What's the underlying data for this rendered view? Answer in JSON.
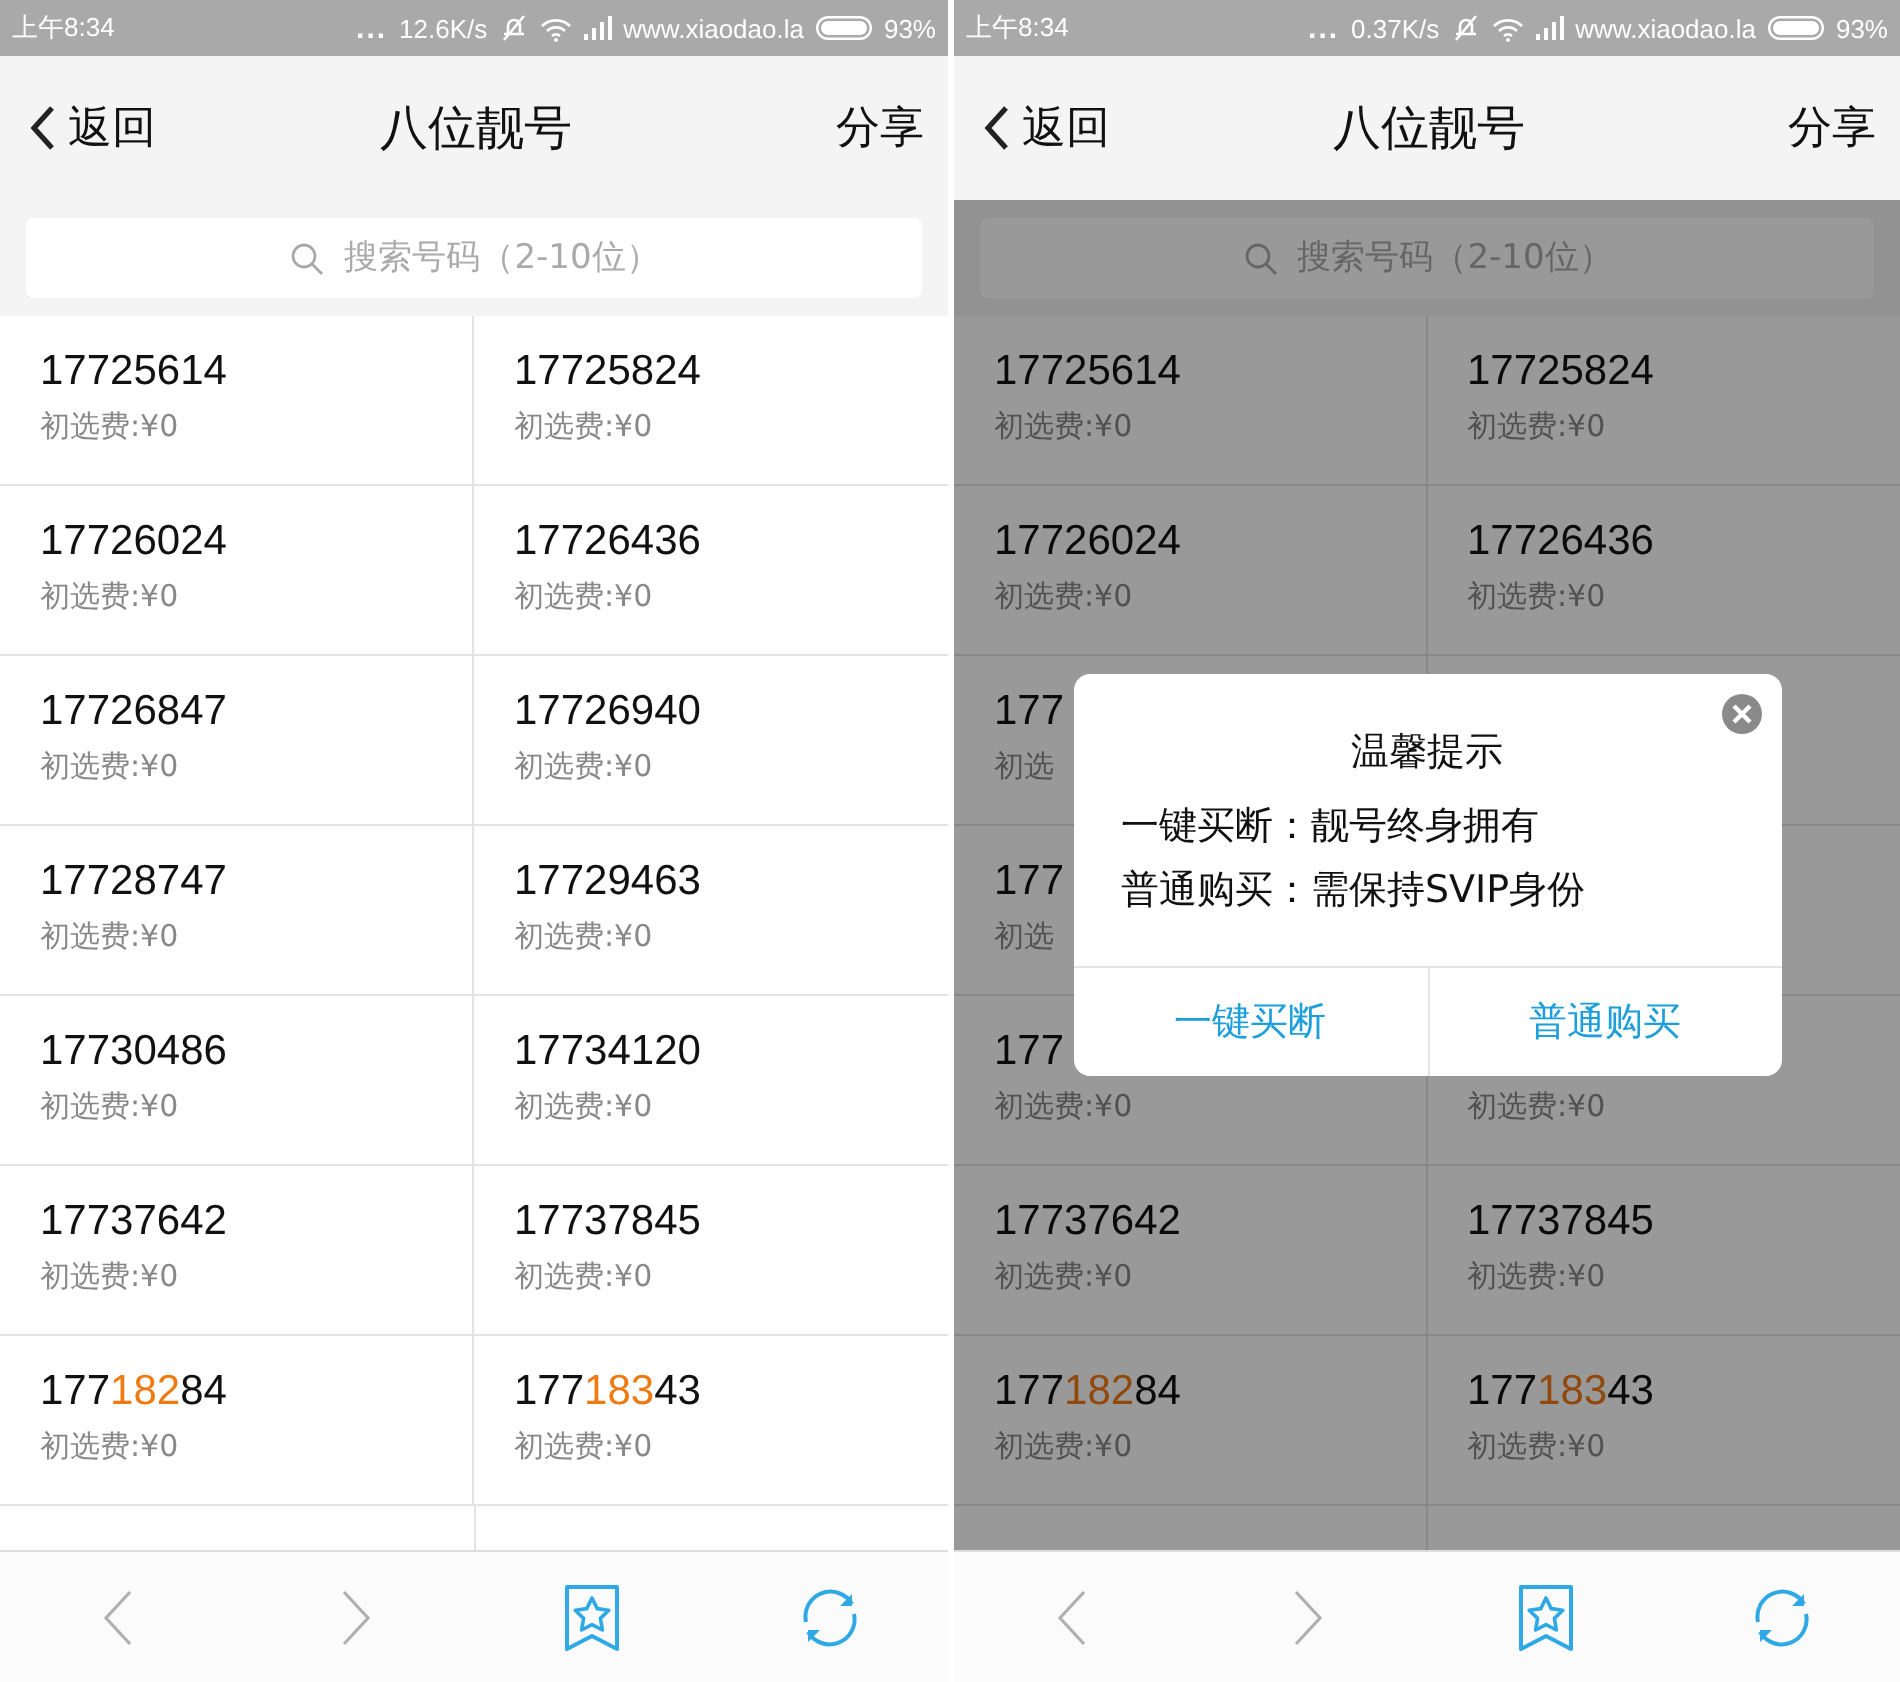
{
  "screens": [
    {
      "dimmed": false,
      "status_bar": {
        "time": "上午8:34",
        "dots": "...",
        "speed": "12.6K/s",
        "site": "www.xiaodao.la",
        "battery": "93%"
      },
      "header": {
        "back": "返回",
        "title": "八位靓号",
        "share": "分享"
      },
      "search": {
        "placeholder": "搜索号码（2-10位）"
      },
      "rows": [
        {
          "cells": [
            {
              "parts": [
                {
                  "text": "17725614",
                  "highlighted": false
                }
              ],
              "fee": "初选费:¥0"
            },
            {
              "parts": [
                {
                  "text": "17725824",
                  "highlighted": false
                }
              ],
              "fee": "初选费:¥0"
            }
          ]
        },
        {
          "cells": [
            {
              "parts": [
                {
                  "text": "17726024",
                  "highlighted": false
                }
              ],
              "fee": "初选费:¥0"
            },
            {
              "parts": [
                {
                  "text": "17726436",
                  "highlighted": false
                }
              ],
              "fee": "初选费:¥0"
            }
          ]
        },
        {
          "cells": [
            {
              "parts": [
                {
                  "text": "17726847",
                  "highlighted": false
                }
              ],
              "fee": "初选费:¥0"
            },
            {
              "parts": [
                {
                  "text": "17726940",
                  "highlighted": false
                }
              ],
              "fee": "初选费:¥0"
            }
          ]
        },
        {
          "cells": [
            {
              "parts": [
                {
                  "text": "17728747",
                  "highlighted": false
                }
              ],
              "fee": "初选费:¥0"
            },
            {
              "parts": [
                {
                  "text": "17729463",
                  "highlighted": false
                }
              ],
              "fee": "初选费:¥0"
            }
          ]
        },
        {
          "cells": [
            {
              "parts": [
                {
                  "text": "17730486",
                  "highlighted": false
                }
              ],
              "fee": "初选费:¥0"
            },
            {
              "parts": [
                {
                  "text": "17734120",
                  "highlighted": false
                }
              ],
              "fee": "初选费:¥0"
            }
          ]
        },
        {
          "cells": [
            {
              "parts": [
                {
                  "text": "17737642",
                  "highlighted": false
                }
              ],
              "fee": "初选费:¥0"
            },
            {
              "parts": [
                {
                  "text": "17737845",
                  "highlighted": false
                }
              ],
              "fee": "初选费:¥0"
            }
          ]
        },
        {
          "cells": [
            {
              "parts": [
                {
                  "text": "177",
                  "highlighted": false
                },
                {
                  "text": "182",
                  "highlighted": true
                },
                {
                  "text": "84",
                  "highlighted": false
                }
              ],
              "fee": "初选费:¥0"
            },
            {
              "parts": [
                {
                  "text": "177",
                  "highlighted": false
                },
                {
                  "text": "183",
                  "highlighted": true
                },
                {
                  "text": "43",
                  "highlighted": false
                }
              ],
              "fee": "初选费:¥0"
            }
          ]
        }
      ],
      "bottom_nav": [
        {
          "kind": "back",
          "disabled": true
        },
        {
          "kind": "forward",
          "disabled": true
        },
        {
          "kind": "bookmark",
          "disabled": false
        },
        {
          "kind": "refresh",
          "disabled": false
        }
      ]
    },
    {
      "dimmed": true,
      "status_bar": {
        "time": "上午8:34",
        "dots": "...",
        "speed": "0.37K/s",
        "site": "www.xiaodao.la",
        "battery": "93%"
      },
      "header": {
        "back": "返回",
        "title": "八位靓号",
        "share": "分享"
      },
      "search": {
        "placeholder": "搜索号码（2-10位）"
      },
      "rows": [
        {
          "cells": [
            {
              "parts": [
                {
                  "text": "17725614",
                  "highlighted": false
                }
              ],
              "fee": "初选费:¥0"
            },
            {
              "parts": [
                {
                  "text": "17725824",
                  "highlighted": false
                }
              ],
              "fee": "初选费:¥0"
            }
          ]
        },
        {
          "cells": [
            {
              "parts": [
                {
                  "text": "17726024",
                  "highlighted": false
                }
              ],
              "fee": "初选费:¥0"
            },
            {
              "parts": [
                {
                  "text": "17726436",
                  "highlighted": false
                }
              ],
              "fee": "初选费:¥0"
            }
          ]
        },
        {
          "cells": [
            {
              "parts": [
                {
                  "text": "177",
                  "highlighted": false
                }
              ],
              "fee": "初选"
            }
          ]
        },
        {
          "cells": [
            {
              "parts": [
                {
                  "text": "177",
                  "highlighted": false
                }
              ],
              "fee": "初选"
            }
          ]
        },
        {
          "cells": [
            {
              "parts": [
                {
                  "text": "177",
                  "highlighted": false
                }
              ],
              "fee": "初选费:¥0"
            },
            {
              "fee": "初选费:¥0"
            }
          ]
        },
        {
          "cells": [
            {
              "parts": [
                {
                  "text": "17737642",
                  "highlighted": false
                }
              ],
              "fee": "初选费:¥0"
            },
            {
              "parts": [
                {
                  "text": "17737845",
                  "highlighted": false
                }
              ],
              "fee": "初选费:¥0"
            }
          ]
        },
        {
          "cells": [
            {
              "parts": [
                {
                  "text": "177",
                  "highlighted": false
                },
                {
                  "text": "182",
                  "highlighted": true
                },
                {
                  "text": "84",
                  "highlighted": false
                }
              ],
              "fee": "初选费:¥0"
            },
            {
              "parts": [
                {
                  "text": "177",
                  "highlighted": false
                },
                {
                  "text": "183",
                  "highlighted": true
                },
                {
                  "text": "43",
                  "highlighted": false
                }
              ],
              "fee": "初选费:¥0"
            }
          ]
        }
      ],
      "dialog": {
        "title": "温馨提示",
        "lines": [
          "一键买断：靓号终身拥有",
          "普通购买：需保持SVIP身份"
        ],
        "buttons": [
          "一键买断",
          "普通购买"
        ]
      },
      "bottom_nav": [
        {
          "kind": "back",
          "disabled": true
        },
        {
          "kind": "forward",
          "disabled": true
        },
        {
          "kind": "bookmark",
          "disabled": false
        },
        {
          "kind": "refresh",
          "disabled": false
        }
      ]
    }
  ]
}
